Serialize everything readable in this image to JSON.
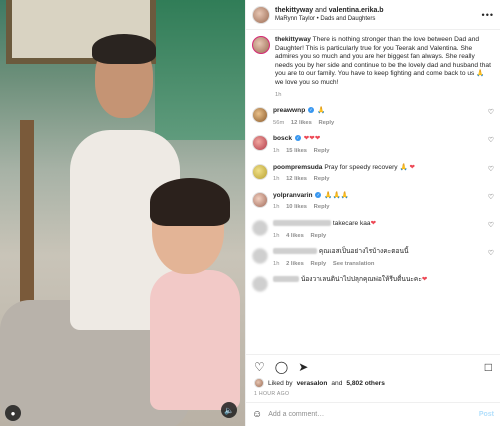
{
  "header": {
    "user1": "thekittyway",
    "and_text": "and",
    "user2": "valentina.erika.b",
    "audio": "MaRynn Taylor • Dads and Daughters",
    "more": "•••"
  },
  "caption": {
    "user": "thekittyway",
    "text": "There is nothing stronger than the love between Dad and Daughter! This is particularly true for you Teerak and Valentina. She admires you so much and you are her biggest fan always. She really needs you by her side and continue to be the lovely dad and husband that you are to our family. You have to keep fighting and come back to us 🙏 we love you so much!",
    "time": "1h"
  },
  "comments": [
    {
      "user": "preawwnp",
      "verified": true,
      "text": "🙏",
      "hearts": 0,
      "time": "56m",
      "likes": "12 likes",
      "reply": "Reply",
      "translate": ""
    },
    {
      "user": "bosck",
      "verified": true,
      "text": "",
      "hearts": 3,
      "time": "1h",
      "likes": "15 likes",
      "reply": "Reply",
      "translate": ""
    },
    {
      "user": "poompremsuda",
      "verified": false,
      "text": "Pray for speedy recovery 🙏",
      "hearts": 1,
      "time": "1h",
      "likes": "12 likes",
      "reply": "Reply",
      "translate": ""
    },
    {
      "user": "yolpranvarin",
      "verified": true,
      "text": "🙏🙏🙏",
      "hearts": 0,
      "time": "1h",
      "likes": "10 likes",
      "reply": "Reply",
      "translate": ""
    },
    {
      "user": "",
      "verified": false,
      "text": "takecare kaa",
      "hearts": 1,
      "time": "1h",
      "likes": "4 likes",
      "reply": "Reply",
      "translate": ""
    },
    {
      "user": "",
      "verified": false,
      "text": "คุณเอสเป็นอย่างไรบ้างคะตอนนี้",
      "hearts": 0,
      "time": "1h",
      "likes": "2 likes",
      "reply": "Reply",
      "translate": "See translation"
    },
    {
      "user": "",
      "verified": false,
      "text": "น้องวาเลนติน่าไปปลุกคุณพ่อให้รีบตื่นนะคะ",
      "hearts": 1,
      "time": "",
      "likes": "",
      "reply": "",
      "translate": ""
    }
  ],
  "actions": {
    "like_icon": "heart-icon",
    "comment_icon": "comment-icon",
    "share_icon": "share-icon",
    "save_icon": "bookmark-icon"
  },
  "likes": {
    "prefix": "Liked by",
    "user": "verasalon",
    "suffix": "and",
    "others": "5,802 others"
  },
  "time_ago": "1 HOUR AGO",
  "add_comment": {
    "placeholder": "Add a comment…",
    "post_label": "Post"
  },
  "colors": {
    "verified": "#3897f0",
    "heart": "#ed4956",
    "post_disabled": "#b2dffc"
  }
}
